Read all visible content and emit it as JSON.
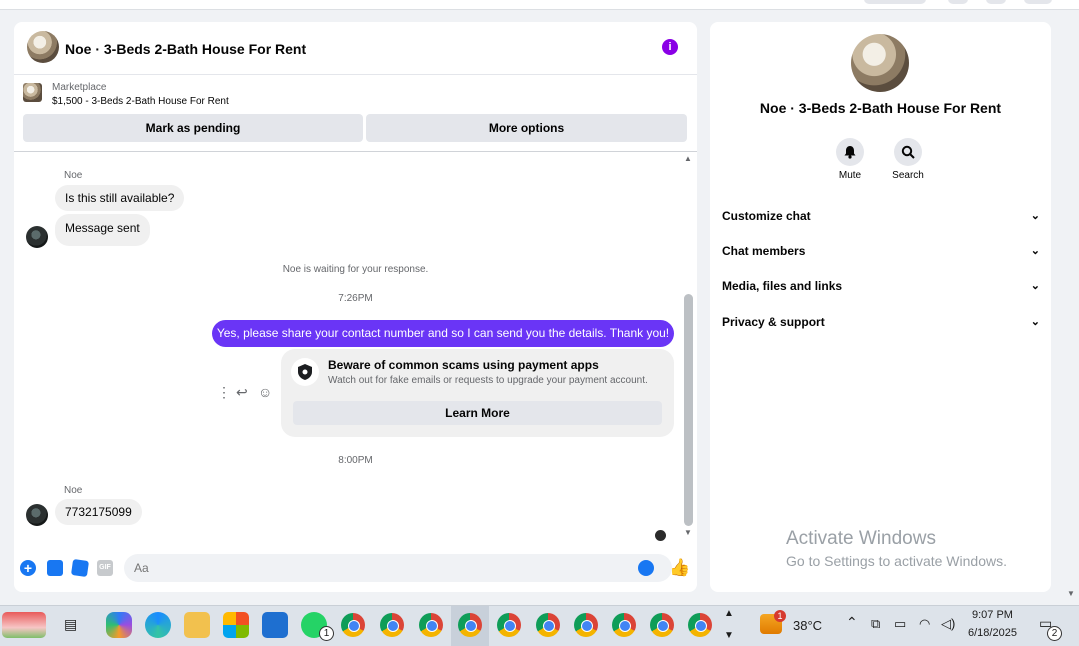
{
  "chat": {
    "title": "Noe · 3-Beds 2-Bath House For Rent",
    "marketplace_label": "Marketplace",
    "listing": "$1,500 - 3-Beds 2-Bath House For Rent",
    "pending_label": "Mark as pending",
    "more_label": "More options",
    "messages": [
      {
        "sender": "Noe",
        "text": "Is this still available?"
      },
      {
        "text": "Message sent"
      }
    ],
    "waiting_note": "Noe is waiting for your response.",
    "time1": "7:26PM",
    "outgoing": "Yes, please share your contact number and so I can send you the details. Thank you!",
    "scam": {
      "title": "Beware of common scams using payment apps",
      "subtitle": "Watch out for fake emails or requests to upgrade your payment account.",
      "button": "Learn More"
    },
    "time2": "8:00PM",
    "last_message": {
      "sender": "Noe",
      "text": "7732175099"
    },
    "composer_placeholder": "Aa"
  },
  "info": {
    "title": "Noe · 3-Beds 2-Bath House For Rent",
    "mute_label": "Mute",
    "search_label": "Search",
    "sections": [
      "Customize chat",
      "Chat members",
      "Media, files and links",
      "Privacy & support"
    ]
  },
  "watermark": {
    "line1": "Activate Windows",
    "line2": "Go to Settings to activate Windows."
  },
  "taskbar": {
    "temperature": "38°C",
    "weather_badge": "1",
    "whatsapp_badge": "1",
    "time": "9:07 PM",
    "date": "6/18/2025",
    "notifications": "2"
  },
  "colors": {
    "accent": "#6a35f6",
    "messenger_blue": "#1877f2",
    "info_purple": "#8a00e6"
  }
}
